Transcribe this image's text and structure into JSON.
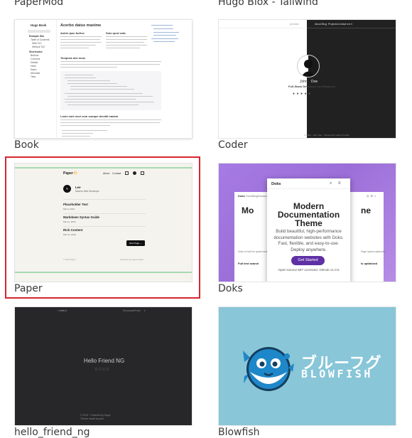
{
  "themes": [
    {
      "label": "PaperMod"
    },
    {
      "label": "Hugo Blox - Tailwind"
    },
    {
      "label": "Book"
    },
    {
      "label": "Coder"
    },
    {
      "label": "Paper",
      "selected": true
    },
    {
      "label": "Doks"
    },
    {
      "label": "hello_friend_ng"
    },
    {
      "label": "Blowfish"
    }
  ],
  "selection_color": "#d6262f",
  "previews": {
    "book": {
      "brand": "Hugo Book",
      "nav": [
        "Example Site",
        "Table of Contents",
        "With ToC",
        "Without ToC",
        "Shortcodes",
        "Buttons",
        "Columns",
        "Details",
        "Hints",
        "Katex",
        "Mermaid",
        "Tabs"
      ],
      "heading": "Acerbo datus maxime",
      "col1_title": "Astris ipse furtive",
      "col2_title": "Suis quot vota",
      "section_title": "Tempora nisi nunc",
      "section2_title": "Locis suis novi cum suoque decidit eadem"
    },
    "coder": {
      "brand": "johndoe",
      "nav": [
        "About",
        "Blog",
        "Projects",
        "Contact me"
      ],
      "name_left": "John",
      "name_right": "Doe",
      "subtitle": "Full-Stack Developer and Magician",
      "footer": "© 2024 · John Doe · Powered by Hugo & Coder."
    },
    "paper": {
      "brand": "Paper",
      "brand_emoji": "🌕",
      "nav": [
        "About",
        "Contact"
      ],
      "author": "Lee",
      "author_sub": "Modern Web Developer",
      "posts": [
        {
          "title": "Placeholder Text",
          "date": "Mar 9, 2019"
        },
        {
          "title": "Markdown Syntax Guide",
          "date": "Mar 11, 2019"
        },
        {
          "title": "Rich Content",
          "date": "Mar 10, 2019"
        }
      ],
      "next_button": "Next Page →",
      "footer_left": "© 2024 Paper",
      "footer_right": "Powered by Hugo & Paper"
    },
    "doks": {
      "brand": "Doks",
      "nav": [
        "Docs",
        "Blog",
        "Showcase"
      ],
      "hero_title": "Modern Documentation Theme",
      "hero_text": "Build beautiful, high-performance documentation websites with Doks. Fast, flexible, and easy-to-use. Deploy anywhere.",
      "cta": "Get Started",
      "license": "Open-source MIT Licensed. GitHub v1.0.0",
      "left_feature": "Full text search",
      "right_feature": "Is optimized"
    },
    "hfng": {
      "brand": "> hello 0",
      "nav": [
        "Showcase",
        "Posts"
      ],
      "title": "Hello Friend NG",
      "footer1": "© 2024 · Powered by Hugo",
      "footer2": "Theme made by panr"
    },
    "blowfish": {
      "title_jp": "ブルーフグ",
      "title_en": "BLOWFISH"
    }
  }
}
